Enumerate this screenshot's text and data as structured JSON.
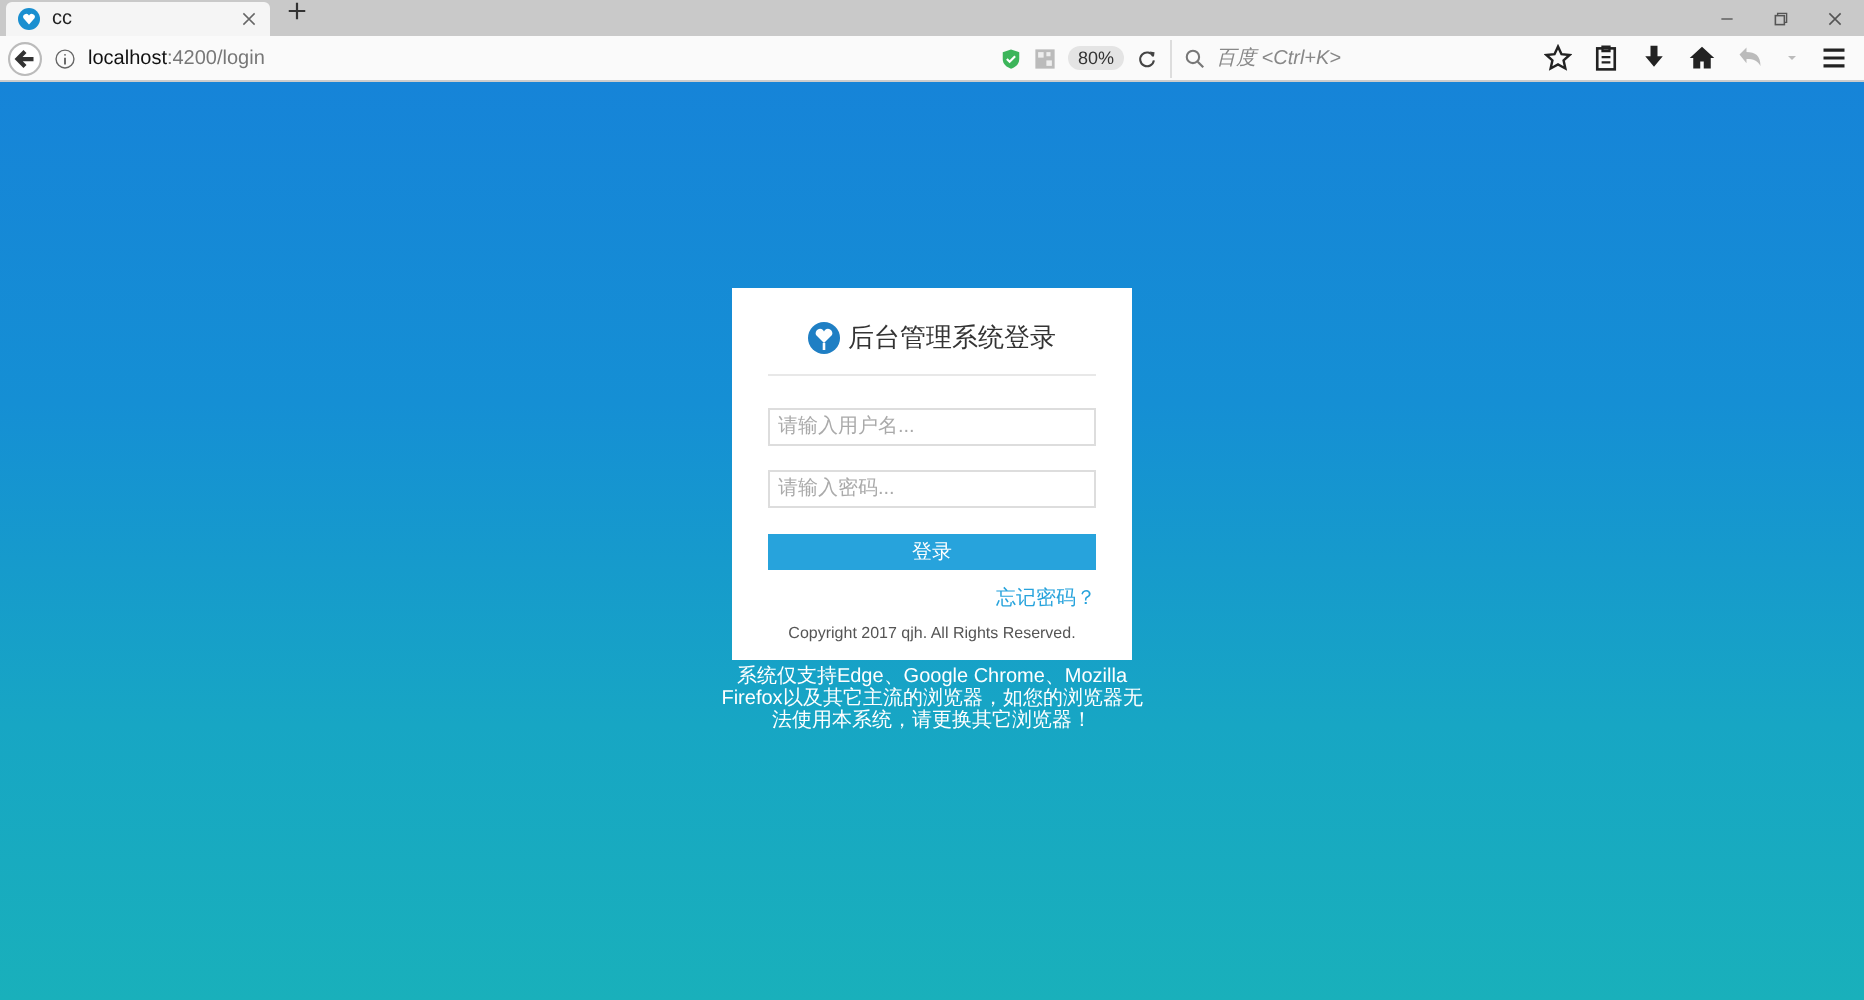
{
  "browser": {
    "tab_title": "cc",
    "url_host": "localhost",
    "url_path": ":4200/login",
    "zoom": "80%",
    "search_placeholder": "百度 <Ctrl+K>"
  },
  "login": {
    "title": "后台管理系统登录",
    "username": {
      "placeholder": "请输入用户名..."
    },
    "password": {
      "placeholder": "请输入密码..."
    },
    "submit": "登录",
    "forgot_link": "忘记密码？",
    "copyright": "Copyright 2017 qjh. All Rights Reserved."
  },
  "notice": "系统仅支持Edge、Google Chrome、Mozilla Firefox以及其它主流的浏览器，如您的浏览器无法使用本系统，请更换其它浏览器！"
}
